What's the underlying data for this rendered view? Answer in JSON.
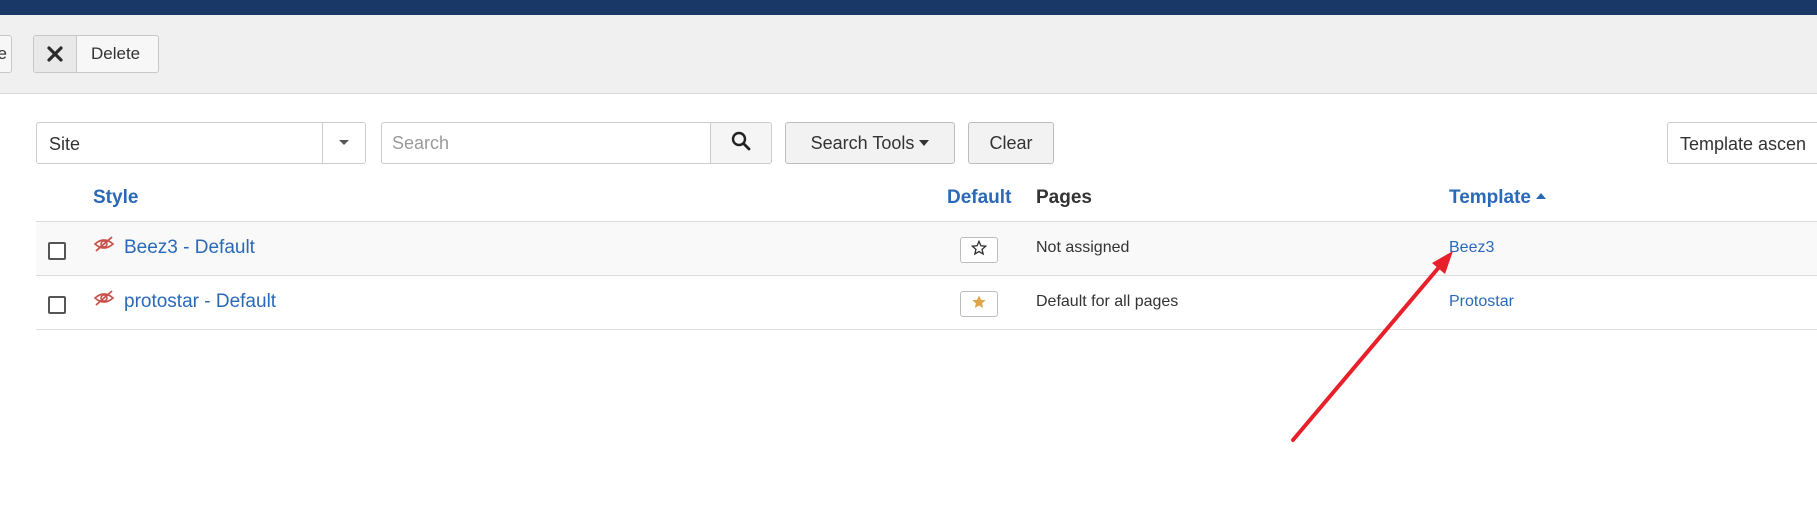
{
  "toolbar": {
    "cut_label": "e",
    "delete_label": "Delete"
  },
  "filters": {
    "client_value": "Site",
    "search_placeholder": "Search",
    "search_tools_label": "Search Tools",
    "clear_label": "Clear",
    "ordering_value": "Template ascen"
  },
  "table": {
    "headers": {
      "style": "Style",
      "default": "Default",
      "pages": "Pages",
      "template": "Template"
    },
    "rows": [
      {
        "style": "Beez3 - Default",
        "default": false,
        "pages": "Not assigned",
        "template": "Beez3"
      },
      {
        "style": "protostar - Default",
        "default": true,
        "pages": "Default for all pages",
        "template": "Protostar"
      }
    ]
  },
  "colors": {
    "topbar": "#1a3867",
    "link": "#2a69b8",
    "star_default": "#e0a34a",
    "annotation_arrow": "#e8202a",
    "eye_icon": "#c9504a"
  }
}
